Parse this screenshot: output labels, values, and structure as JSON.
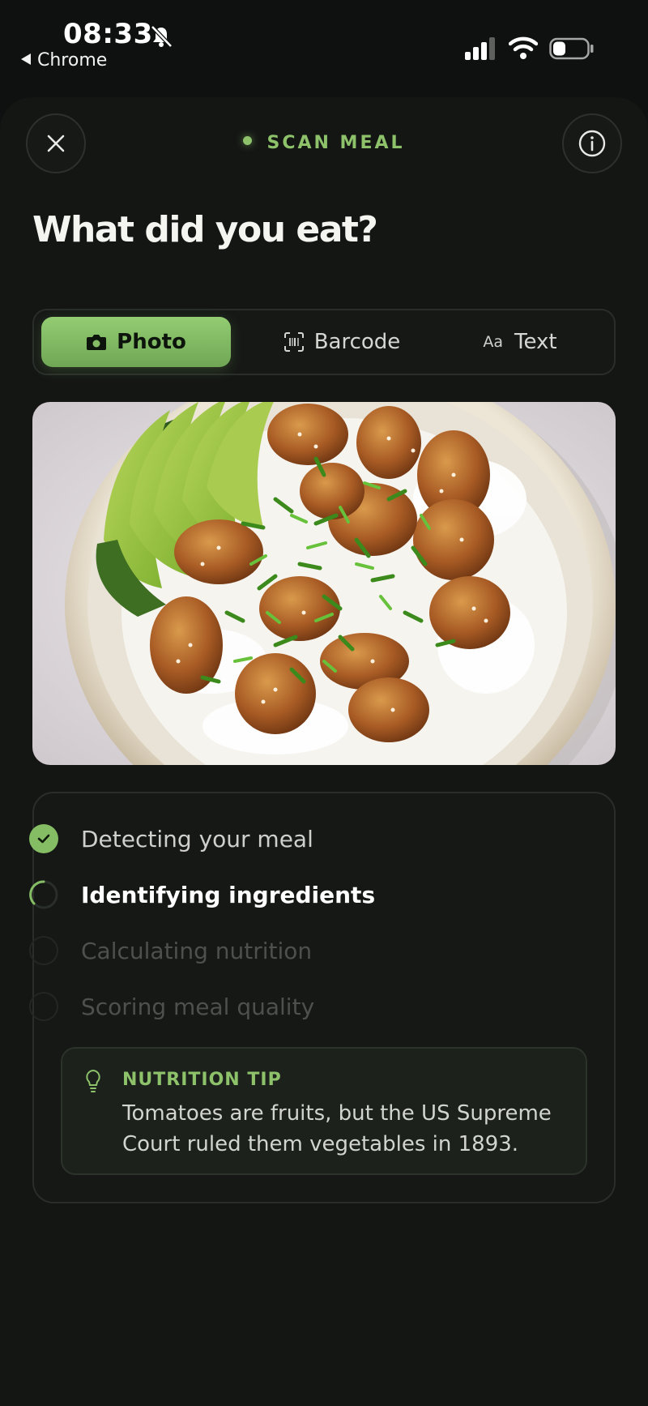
{
  "status_bar": {
    "time": "08:33",
    "back_app": "Chrome"
  },
  "header": {
    "title": "SCAN MEAL",
    "accent_color": "#8dc26b"
  },
  "main": {
    "heading": "What did you eat?",
    "tabs": [
      {
        "label": "Photo",
        "icon": "camera-icon",
        "selected": true
      },
      {
        "label": "Barcode",
        "icon": "barcode-scan-icon",
        "selected": false
      },
      {
        "label": "Text",
        "icon": "text-aa-icon",
        "icon_text": "Aa",
        "selected": false
      }
    ],
    "photo": {
      "subject": "food-photo-bowl"
    },
    "steps": [
      {
        "label": "Detecting your meal",
        "state": "done"
      },
      {
        "label": "Identifying ingredients",
        "state": "in-progress"
      },
      {
        "label": "Calculating nutrition",
        "state": "pending"
      },
      {
        "label": "Scoring meal quality",
        "state": "pending"
      }
    ],
    "tip": {
      "heading": "NUTRITION TIP",
      "body": "Tomatoes are fruits, but the US Supreme Court ruled them vegetables in 1893."
    }
  }
}
